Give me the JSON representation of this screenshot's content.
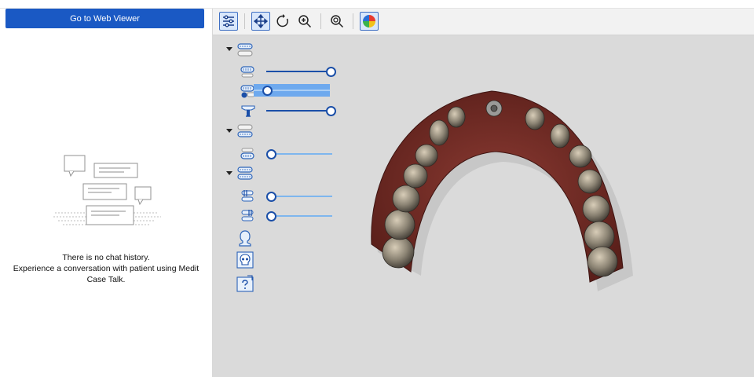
{
  "left_panel": {
    "web_viewer_button": "Go to Web Viewer",
    "empty_state": {
      "line1": "There is no chat history.",
      "line2": "Experience a conversation with patient using Medit",
      "line3": "Case Talk."
    }
  },
  "toolbar": {
    "items": [
      {
        "name": "settings-sliders-icon",
        "active": true
      },
      {
        "name": "pan-move-icon",
        "active": true
      },
      {
        "name": "rotate-icon",
        "active": false
      },
      {
        "name": "zoom-in-icon",
        "active": false
      },
      {
        "name": "zoom-fit-icon",
        "active": false
      },
      {
        "name": "color-map-icon",
        "active": true
      }
    ]
  },
  "layers": {
    "groups": [
      {
        "name": "maxilla-group",
        "expanded": true,
        "items": [
          {
            "icon": "upper-jaw-icon",
            "opacity": 1.0
          },
          {
            "icon": "upper-jaw-pretreatment-icon",
            "opacity": 0.0,
            "highlighted": true
          },
          {
            "icon": "implant-scanbody-icon",
            "opacity": 1.0
          }
        ]
      },
      {
        "name": "mandible-group",
        "expanded": true,
        "items": [
          {
            "icon": "lower-jaw-icon",
            "opacity": 0.0
          }
        ]
      },
      {
        "name": "occlusion-group",
        "expanded": true,
        "items": [
          {
            "icon": "occlusion-1-icon",
            "opacity": 0.0
          },
          {
            "icon": "occlusion-2-icon",
            "opacity": 0.0
          }
        ]
      }
    ],
    "extras": [
      "face-scan-icon",
      "skull-ct-icon",
      "unknown-data-icon"
    ]
  }
}
